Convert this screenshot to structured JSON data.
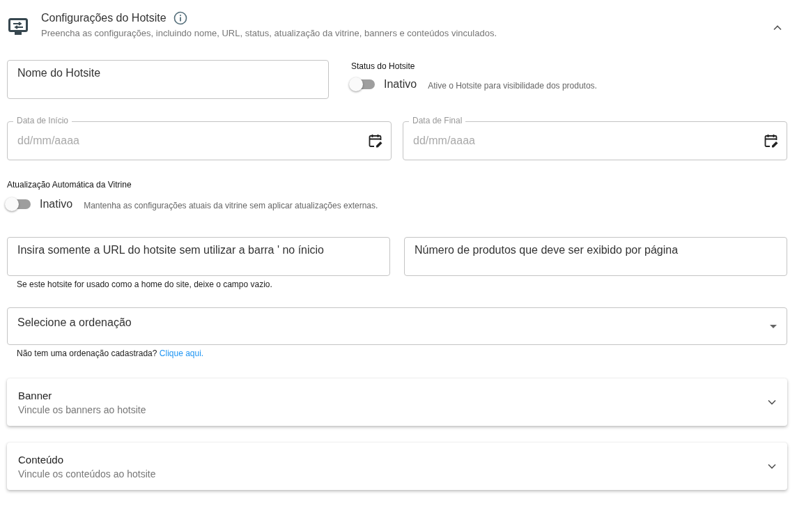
{
  "header": {
    "title": "Configurações do Hotsite",
    "subtitle": "Preencha as configurações, incluindo nome, URL, status, atualização da vitrine, banners e conteúdos vinculados.",
    "expanded": true
  },
  "name_field": {
    "placeholder": "Nome do Hotsite"
  },
  "status": {
    "label": "Status do Hotsite",
    "on": false,
    "state_text": "Inativo",
    "hint": "Ative o Hotsite para visibilidade dos produtos."
  },
  "date_fields": [
    {
      "label": "Data de Início",
      "placeholder": "dd/mm/aaaa"
    },
    {
      "label": "Data de Final",
      "placeholder": "dd/mm/aaaa"
    }
  ],
  "auto_update": {
    "label": "Atualização Automática da Vitrine",
    "on": false,
    "state_text": "Inativo",
    "hint": "Mantenha as configurações atuais da vitrine sem aplicar atualizações externas."
  },
  "url_field": {
    "placeholder": "Insira somente a URL do hotsite sem utilizar a barra ' no ínicio",
    "helper": "Se este hotsite for usado como a home do site, deixe o campo vazio."
  },
  "products_field": {
    "placeholder": "Número de produtos que deve ser exibido por página"
  },
  "sort_select": {
    "placeholder": "Selecione a ordenação",
    "helper": "Não tem uma ordenação cadastrada?",
    "link": "Clique aqui."
  },
  "sections": [
    {
      "title": "Banner",
      "subtitle": "Vincule os banners ao hotsite",
      "expanded": false
    },
    {
      "title": "Conteúdo",
      "subtitle": "Vincule os conteúdos ao hotsite",
      "expanded": false
    }
  ]
}
